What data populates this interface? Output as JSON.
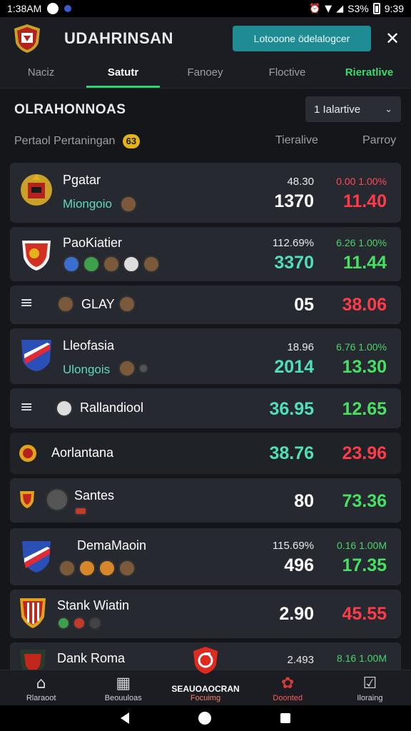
{
  "status_bar": {
    "time": "1:38AM",
    "battery_text": "S3%",
    "clock": "9:39"
  },
  "header": {
    "title": "UDAHRINSAN",
    "promo_label": "Lotooone ödelalogcer",
    "close_glyph": "✕"
  },
  "tabs": [
    {
      "label": "Naciz"
    },
    {
      "label": "Satutr"
    },
    {
      "label": "Fanoey"
    },
    {
      "label": "Floctive"
    },
    {
      "label": "Rieratlive"
    }
  ],
  "section": {
    "title": "OLRAHONNOAS",
    "filter_label": "1  Ialartive",
    "subtitle": "Pertaol Pertaningan",
    "badge": "63",
    "col_a": "Tieralive",
    "col_b": "Parroy"
  },
  "rows": [
    {
      "name": "Pgatar",
      "sub": "Miongoio",
      "small_a": "48.30",
      "big_a": "1370",
      "small_b": "0.00 1.00%",
      "big_b": "11.40"
    },
    {
      "name": "PaoKiatier",
      "sub": "",
      "small_a": "112.69%",
      "big_a": "3370",
      "small_b": "6.26 1.00%",
      "big_b": "11.44"
    },
    {
      "name": "GLAY",
      "sub": "",
      "small_a": "",
      "big_a": "05",
      "small_b": "",
      "big_b": "38.06"
    },
    {
      "name": "Lleofasia",
      "sub": "Ulongois",
      "small_a": "18.96",
      "big_a": "2014",
      "small_b": "6.76 1.00%",
      "big_b": "13.30"
    },
    {
      "name": "Rallandiool",
      "sub": "",
      "small_a": "",
      "big_a": "36.95",
      "small_b": "",
      "big_b": "12.65"
    },
    {
      "name": "Aorlantana",
      "sub": "",
      "small_a": "",
      "big_a": "38.76",
      "small_b": "",
      "big_b": "23.96"
    },
    {
      "name": "Santes",
      "sub": "",
      "small_a": "",
      "big_a": "80",
      "small_b": "",
      "big_b": "73.36"
    },
    {
      "name": "DemaMaoin",
      "sub": "",
      "small_a": "115.69%",
      "big_a": "496",
      "small_b": "0.16 1.00M",
      "big_b": "17.35"
    },
    {
      "name": "Stank Wiatin",
      "sub": "",
      "small_a": "",
      "big_a": "2.90",
      "small_b": "",
      "big_b": "45.55"
    },
    {
      "name": "Dank Roma",
      "sub": "",
      "small_a": "2.493",
      "big_a": "",
      "small_b": "8.16 1.00M",
      "big_b": ""
    }
  ],
  "bottom_nav": [
    {
      "label": "Rlaraoot",
      "icon": "home-icon"
    },
    {
      "label": "Beouuloas",
      "icon": "stats-icon"
    },
    {
      "label_top": "SEAUOAOCRAN",
      "label_bot": "Focuimg",
      "icon": "logo-badge-icon"
    },
    {
      "label": "Doonted",
      "icon": "gift-icon"
    },
    {
      "label": "Iloraing",
      "icon": "clipboard-icon"
    }
  ],
  "colors": {
    "accent_green": "#2ed36b",
    "promo": "#1f8c93",
    "red": "#ff3b4a",
    "teal": "#4fe0b8",
    "bg": "#14161a",
    "card": "#262930"
  }
}
